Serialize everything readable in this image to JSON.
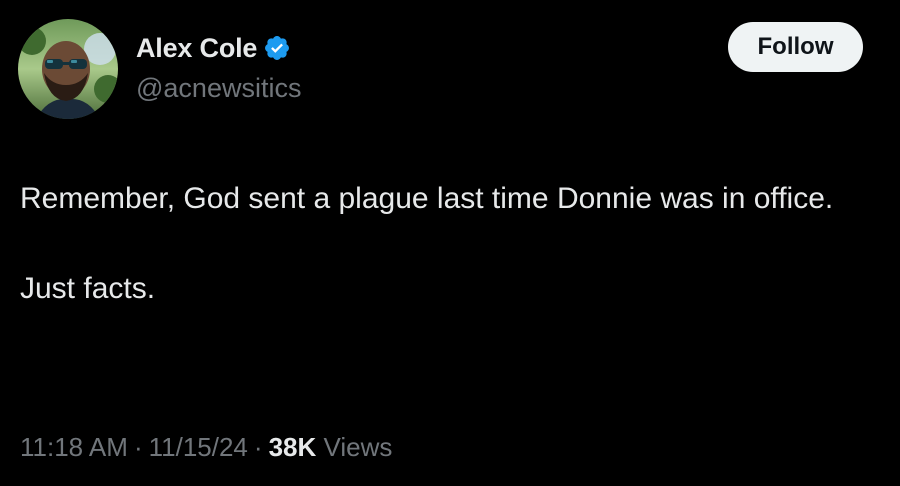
{
  "author": {
    "display_name": "Alex Cole",
    "handle": "@acnewsitics",
    "verified": true,
    "verified_color": "#1d9bf0"
  },
  "follow_button": {
    "label": "Follow"
  },
  "tweet": {
    "paragraphs": [
      "Remember, God sent a plague last time Donnie was in office.",
      "Just facts."
    ]
  },
  "meta": {
    "time": "11:18 AM",
    "separator": "·",
    "date": "11/15/24",
    "views_count": "38K",
    "views_label": "Views"
  },
  "colors": {
    "background": "#000000",
    "text_primary": "#e7e9ea",
    "text_secondary": "#71767b",
    "follow_bg": "#eff3f4"
  }
}
